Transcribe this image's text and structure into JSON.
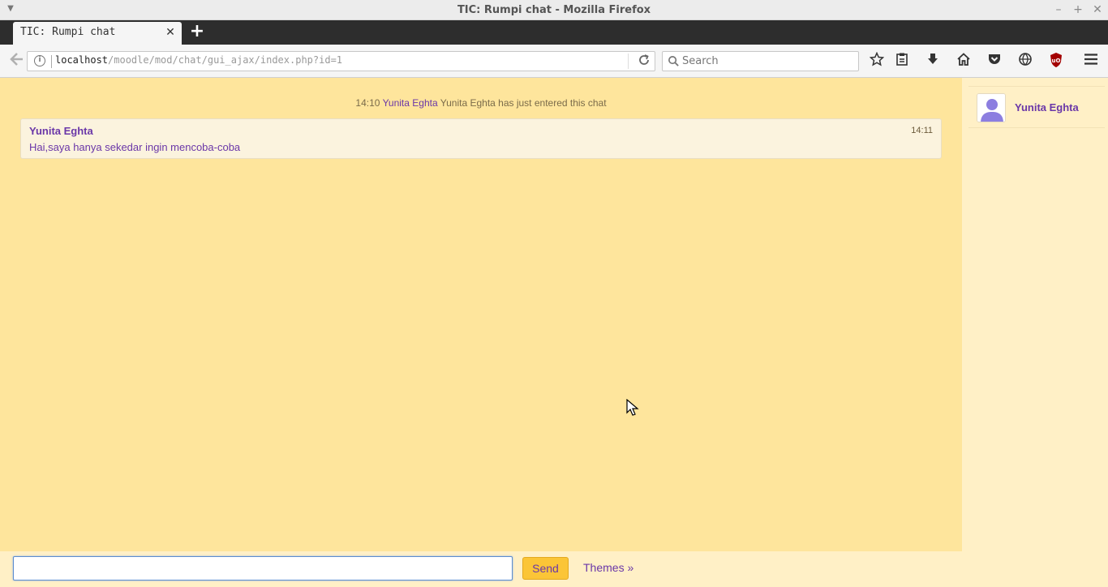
{
  "window": {
    "title": "TIC: Rumpi chat - Mozilla Firefox",
    "minimize_icon": "–",
    "maximize_icon": "+",
    "close_icon": "✕"
  },
  "tabs": [
    {
      "label": "TIC: Rumpi chat",
      "active": true
    }
  ],
  "navbar": {
    "url_host": "localhost",
    "url_path": "/moodle/mod/chat/gui_ajax/index.php?id=1",
    "search_placeholder": "Search"
  },
  "chat": {
    "system_message": {
      "time": "14:10",
      "user": "Yunita Eghta",
      "text": "Yunita Eghta has just entered this chat"
    },
    "messages": [
      {
        "user": "Yunita Eghta",
        "time": "14:11",
        "text": "Hai,saya hanya sekedar ingin mencoba-coba"
      }
    ]
  },
  "users": [
    {
      "name": "Yunita Eghta"
    }
  ],
  "input": {
    "value": "",
    "send_label": "Send",
    "themes_label": "Themes »"
  },
  "colors": {
    "chat_bg": "#fee59c",
    "userlist_bg": "#fff0c6",
    "accent_purple": "#6a37a8",
    "send_button": "#fbc537"
  }
}
